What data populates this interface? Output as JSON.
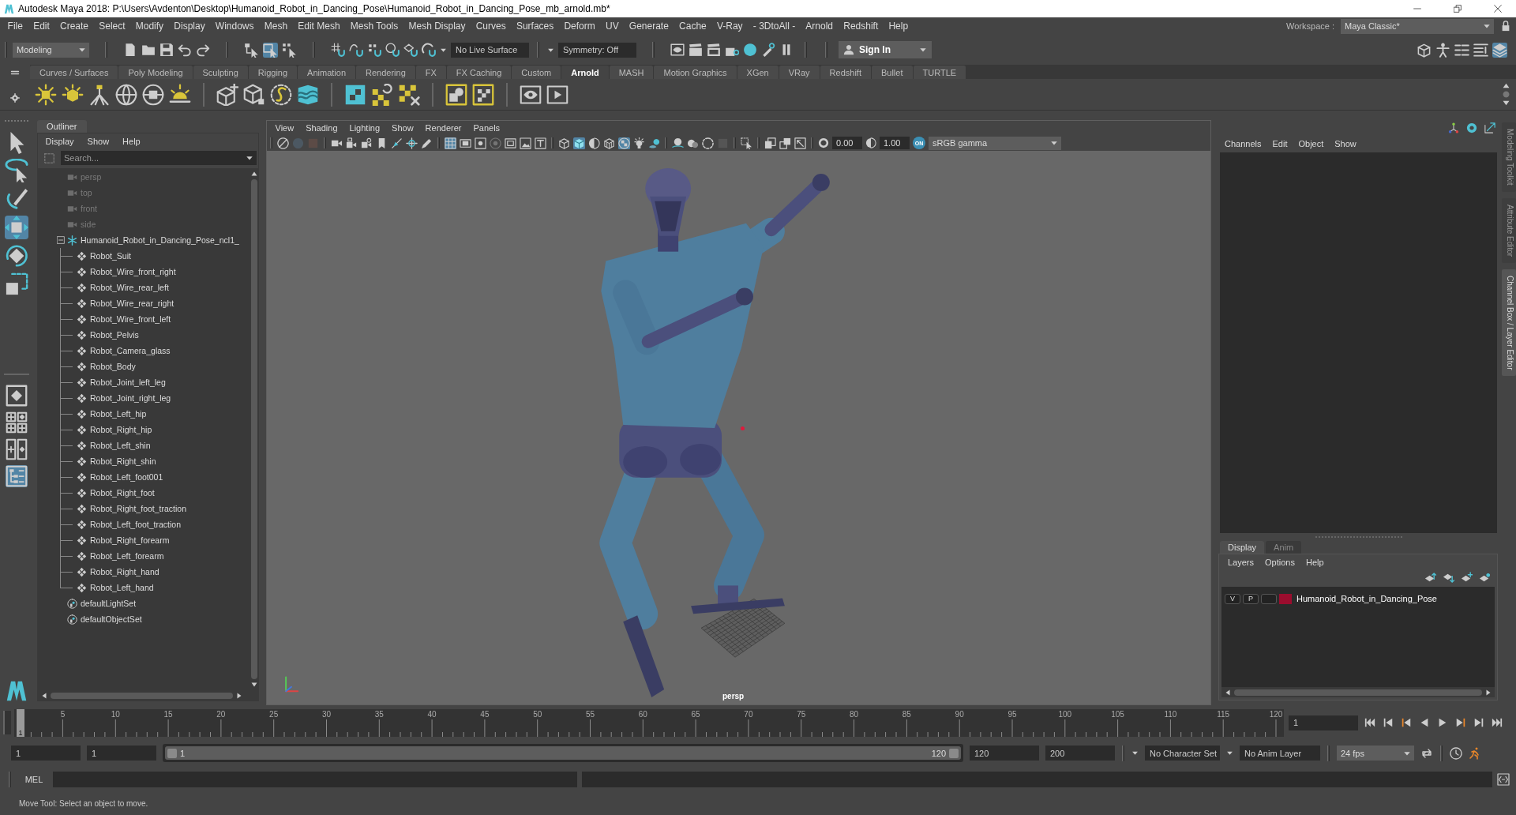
{
  "window": {
    "title": "Autodesk Maya 2018: P:\\Users\\Avdenton\\Desktop\\Humanoid_Robot_in_Dancing_Pose\\Humanoid_Robot_in_Dancing_Pose_mb_arnold.mb*"
  },
  "menu_bar": {
    "items": [
      "File",
      "Edit",
      "Create",
      "Select",
      "Modify",
      "Display",
      "Windows",
      "Mesh",
      "Edit Mesh",
      "Mesh Tools",
      "Mesh Display",
      "Curves",
      "Surfaces",
      "Deform",
      "UV",
      "Generate",
      "Cache",
      "V-Ray",
      "- 3DtoAll -",
      "Arnold",
      "Redshift",
      "Help"
    ],
    "workspace_label": "Workspace :",
    "workspace": "Maya Classic*"
  },
  "status_line": {
    "menu_set": "Modeling",
    "selection_modes": [
      {
        "selected": false
      },
      {
        "selected": true
      },
      {
        "selected": false
      }
    ],
    "live_surface": "No Live Surface",
    "symmetry": "Symmetry: Off",
    "sign_in": "Sign In",
    "panel_toggles": [
      {
        "on": false
      },
      {
        "on": false
      },
      {
        "on": false
      },
      {
        "on": false
      },
      {
        "on": true
      }
    ]
  },
  "shelf": {
    "tabs": [
      {
        "label": "Curves / Surfaces",
        "selected": false
      },
      {
        "label": "Poly Modeling",
        "selected": false
      },
      {
        "label": "Sculpting",
        "selected": false
      },
      {
        "label": "Rigging",
        "selected": false
      },
      {
        "label": "Animation",
        "selected": false
      },
      {
        "label": "Rendering",
        "selected": false
      },
      {
        "label": "FX",
        "selected": false
      },
      {
        "label": "FX Caching",
        "selected": false
      },
      {
        "label": "Custom",
        "selected": false
      },
      {
        "label": "Arnold",
        "selected": true
      },
      {
        "label": "MASH",
        "selected": false
      },
      {
        "label": "Motion Graphics",
        "selected": false
      },
      {
        "label": "XGen",
        "selected": false
      },
      {
        "label": "VRay",
        "selected": false
      },
      {
        "label": "Redshift",
        "selected": false
      },
      {
        "label": "Bullet",
        "selected": false
      },
      {
        "label": "TURTLE",
        "selected": false
      }
    ]
  },
  "toolbox": {
    "tools": [
      {
        "selected": false
      },
      {
        "selected": false
      },
      {
        "selected": false
      },
      {
        "selected": true
      },
      {
        "selected": false
      },
      {
        "selected": false
      }
    ],
    "layouts": [
      {
        "selected": false
      },
      {
        "selected": false
      },
      {
        "selected": false
      },
      {
        "selected": true
      }
    ]
  },
  "outliner": {
    "tab": "Outliner",
    "menu": [
      "Display",
      "Show",
      "Help"
    ],
    "search": {
      "placeholder": "Search..."
    },
    "items": [
      {
        "kind": "camera",
        "label": "persp",
        "hidden": true
      },
      {
        "kind": "camera",
        "label": "top",
        "hidden": true
      },
      {
        "kind": "camera",
        "label": "front",
        "hidden": true
      },
      {
        "kind": "camera",
        "label": "side",
        "hidden": true
      },
      {
        "kind": "group",
        "label": "Humanoid_Robot_in_Dancing_Pose_ncl1_",
        "hidden": false,
        "expanded": true,
        "children": [
          {
            "kind": "mesh",
            "label": "Robot_Suit",
            "hidden": false
          },
          {
            "kind": "mesh",
            "label": "Robot_Wire_front_right",
            "hidden": false
          },
          {
            "kind": "mesh",
            "label": "Robot_Wire_rear_left",
            "hidden": false
          },
          {
            "kind": "mesh",
            "label": "Robot_Wire_rear_right",
            "hidden": false
          },
          {
            "kind": "mesh",
            "label": "Robot_Wire_front_left",
            "hidden": false
          },
          {
            "kind": "mesh",
            "label": "Robot_Pelvis",
            "hidden": false
          },
          {
            "kind": "mesh",
            "label": "Robot_Camera_glass",
            "hidden": false
          },
          {
            "kind": "mesh",
            "label": "Robot_Body",
            "hidden": false
          },
          {
            "kind": "mesh",
            "label": "Robot_Joint_left_leg",
            "hidden": false
          },
          {
            "kind": "mesh",
            "label": "Robot_Joint_right_leg",
            "hidden": false
          },
          {
            "kind": "mesh",
            "label": "Robot_Left_hip",
            "hidden": false
          },
          {
            "kind": "mesh",
            "label": "Robot_Right_hip",
            "hidden": false
          },
          {
            "kind": "mesh",
            "label": "Robot_Left_shin",
            "hidden": false
          },
          {
            "kind": "mesh",
            "label": "Robot_Right_shin",
            "hidden": false
          },
          {
            "kind": "mesh",
            "label": "Robot_Left_foot001",
            "hidden": false
          },
          {
            "kind": "mesh",
            "label": "Robot_Right_foot",
            "hidden": false
          },
          {
            "kind": "mesh",
            "label": "Robot_Right_foot_traction",
            "hidden": false
          },
          {
            "kind": "mesh",
            "label": "Robot_Left_foot_traction",
            "hidden": false
          },
          {
            "kind": "mesh",
            "label": "Robot_Right_forearm",
            "hidden": false
          },
          {
            "kind": "mesh",
            "label": "Robot_Left_forearm",
            "hidden": false
          },
          {
            "kind": "mesh",
            "label": "Robot_Right_hand",
            "hidden": false
          },
          {
            "kind": "mesh",
            "label": "Robot_Left_hand",
            "hidden": false
          }
        ]
      },
      {
        "kind": "set",
        "label": "defaultLightSet",
        "hidden": false
      },
      {
        "kind": "set",
        "label": "defaultObjectSet",
        "hidden": false
      }
    ]
  },
  "viewport": {
    "menu": [
      "View",
      "Shading",
      "Lighting",
      "Show",
      "Renderer",
      "Panels"
    ],
    "toolbar": {
      "buttons": [
        {
          "on": false,
          "disabled": false
        },
        {
          "on": false,
          "disabled": true
        },
        {
          "on": false,
          "disabled": true
        },
        {
          "on": false,
          "disabled": false
        },
        {
          "on": false,
          "disabled": false
        },
        {
          "on": false,
          "disabled": false
        },
        {
          "on": false,
          "disabled": false
        },
        {
          "on": false,
          "disabled": false
        },
        {
          "on": false,
          "disabled": false
        },
        {
          "on": false,
          "disabled": false
        },
        {
          "on": true,
          "disabled": false
        },
        {
          "on": false,
          "disabled": false
        },
        {
          "on": false,
          "disabled": false
        },
        {
          "on": false,
          "disabled": true
        },
        {
          "on": false,
          "disabled": false
        },
        {
          "on": false,
          "disabled": false
        },
        {
          "on": false,
          "disabled": false
        },
        {
          "on": false,
          "disabled": false
        },
        {
          "on": true,
          "disabled": false
        },
        {
          "on": false,
          "disabled": false
        },
        {
          "on": false,
          "disabled": false
        },
        {
          "on": true,
          "disabled": false
        },
        {
          "on": false,
          "disabled": false
        },
        {
          "on": false,
          "disabled": false
        },
        {
          "on": false,
          "disabled": false
        },
        {
          "on": false,
          "disabled": false
        },
        {
          "on": false,
          "disabled": false
        },
        {
          "on": false,
          "disabled": true
        },
        {
          "on": false,
          "disabled": false
        },
        {
          "on": false,
          "disabled": false
        },
        {
          "on": false,
          "disabled": false
        },
        {
          "on": false,
          "disabled": false
        }
      ],
      "exposure": "0.00",
      "gamma": "1.00",
      "color_management": "ON",
      "color_space": "sRGB gamma"
    },
    "camera": "persp"
  },
  "channel_box": {
    "menu": [
      "Channels",
      "Edit",
      "Object",
      "Show"
    ]
  },
  "layer_editor": {
    "tabs": [
      {
        "label": "Display",
        "selected": true
      },
      {
        "label": "Anim",
        "selected": false
      }
    ],
    "menu": [
      "Layers",
      "Options",
      "Help"
    ],
    "layers": [
      {
        "visibility": "V",
        "playback": "P",
        "template": false,
        "color": "#9b0d2e",
        "name": "Humanoid_Robot_in_Dancing_Pose"
      }
    ]
  },
  "side_tabs": [
    {
      "label": "Modeling Toolkit",
      "selected": false
    },
    {
      "label": "Attribute Editor",
      "selected": false
    },
    {
      "label": "Channel Box / Layer Editor",
      "selected": true
    }
  ],
  "time_slider": {
    "ticks": [
      "5",
      "10",
      "15",
      "20",
      "25",
      "30",
      "35",
      "40",
      "45",
      "50",
      "55",
      "60",
      "65",
      "70",
      "75",
      "80",
      "85",
      "90",
      "95",
      "100",
      "105",
      "110",
      "115",
      "120"
    ],
    "current_frame": "1",
    "level": 0,
    "current_time": "1"
  },
  "range_slider": {
    "animation_start": "1",
    "playback_start": "1",
    "range_start": "1",
    "range_end": "120",
    "level": 1,
    "playback_end": "120",
    "animation_end": "200",
    "character_set": "No Character Set",
    "anim_layer": "No Anim Layer",
    "fps": "24 fps"
  },
  "command_line": {
    "language": "MEL"
  },
  "help_line": {
    "text": "Move Tool: Select an object to move."
  }
}
